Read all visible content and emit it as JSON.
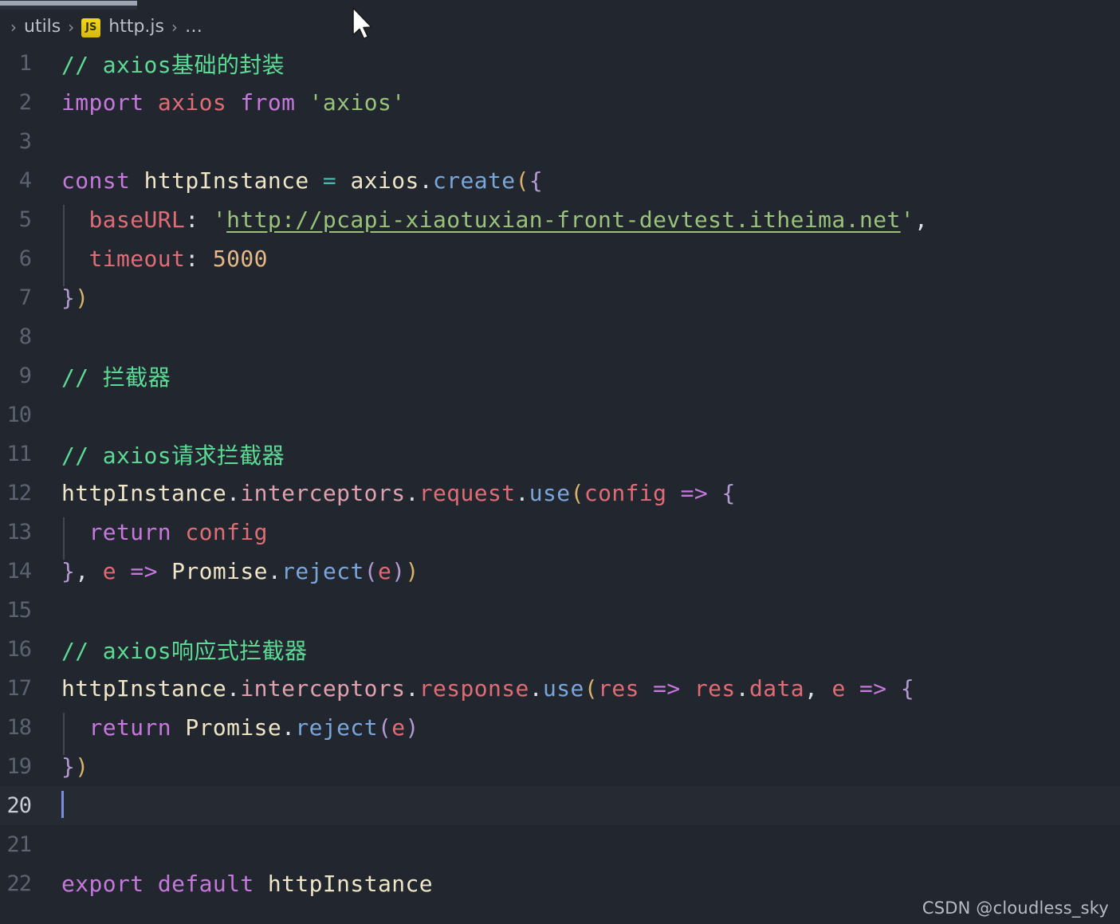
{
  "window": {
    "app": "Visual Studio Code",
    "theme_background": "#22262e"
  },
  "tab": {
    "label": "http.js",
    "active": true
  },
  "breadcrumb": {
    "separator": "›",
    "items": [
      {
        "label": "utils",
        "icon": "folder-icon"
      },
      {
        "label": "http.js",
        "icon": "js-file-icon",
        "badge": "JS"
      },
      {
        "label": "…",
        "icon": "ellipsis-icon"
      }
    ]
  },
  "editor": {
    "filename": "http.js",
    "language": "javascript",
    "active_line": 20,
    "cursor_line": 20,
    "cursor_column": 1,
    "total_lines_visible": 22,
    "lines": [
      {
        "n": 1,
        "tokens": [
          {
            "t": "// axios基础的封装",
            "c": "t-comment"
          }
        ]
      },
      {
        "n": 2,
        "tokens": [
          {
            "t": "import",
            "c": "t-keyword"
          },
          {
            "t": " ",
            "c": "t-plain"
          },
          {
            "t": "axios",
            "c": "t-var"
          },
          {
            "t": " ",
            "c": "t-plain"
          },
          {
            "t": "from",
            "c": "t-keyword"
          },
          {
            "t": " ",
            "c": "t-plain"
          },
          {
            "t": "'axios'",
            "c": "t-string"
          }
        ]
      },
      {
        "n": 3,
        "tokens": []
      },
      {
        "n": 4,
        "tokens": [
          {
            "t": "const",
            "c": "t-keyword"
          },
          {
            "t": " ",
            "c": "t-plain"
          },
          {
            "t": "httpInstance",
            "c": "t-ident"
          },
          {
            "t": " ",
            "c": "t-plain"
          },
          {
            "t": "=",
            "c": "t-op"
          },
          {
            "t": " ",
            "c": "t-plain"
          },
          {
            "t": "axios",
            "c": "t-ident"
          },
          {
            "t": ".",
            "c": "t-plain"
          },
          {
            "t": "create",
            "c": "t-method"
          },
          {
            "t": "(",
            "c": "t-paren1"
          },
          {
            "t": "{",
            "c": "t-paren2"
          }
        ]
      },
      {
        "n": 5,
        "indent": true,
        "tokens": [
          {
            "t": "  ",
            "c": "t-plain"
          },
          {
            "t": "baseURL",
            "c": "t-var"
          },
          {
            "t": ": ",
            "c": "t-plain"
          },
          {
            "t": "'",
            "c": "t-string"
          },
          {
            "t": "http://pcapi-xiaotuxian-front-devtest.itheima.net",
            "c": "t-link"
          },
          {
            "t": "'",
            "c": "t-string"
          },
          {
            "t": ",",
            "c": "t-plain"
          }
        ]
      },
      {
        "n": 6,
        "indent": true,
        "tokens": [
          {
            "t": "  ",
            "c": "t-plain"
          },
          {
            "t": "timeout",
            "c": "t-var"
          },
          {
            "t": ": ",
            "c": "t-plain"
          },
          {
            "t": "5000",
            "c": "t-number"
          }
        ]
      },
      {
        "n": 7,
        "tokens": [
          {
            "t": "}",
            "c": "t-paren2"
          },
          {
            "t": ")",
            "c": "t-paren1"
          }
        ]
      },
      {
        "n": 8,
        "tokens": []
      },
      {
        "n": 9,
        "tokens": [
          {
            "t": "// 拦截器",
            "c": "t-comment"
          }
        ]
      },
      {
        "n": 10,
        "tokens": []
      },
      {
        "n": 11,
        "tokens": [
          {
            "t": "// axios请求拦截器",
            "c": "t-comment"
          }
        ]
      },
      {
        "n": 12,
        "tokens": [
          {
            "t": "httpInstance",
            "c": "t-ident"
          },
          {
            "t": ".",
            "c": "t-plain"
          },
          {
            "t": "interceptors",
            "c": "t-prop"
          },
          {
            "t": ".",
            "c": "t-plain"
          },
          {
            "t": "request",
            "c": "t-var"
          },
          {
            "t": ".",
            "c": "t-plain"
          },
          {
            "t": "use",
            "c": "t-method"
          },
          {
            "t": "(",
            "c": "t-paren1"
          },
          {
            "t": "config",
            "c": "t-var"
          },
          {
            "t": " ",
            "c": "t-plain"
          },
          {
            "t": "=>",
            "c": "t-arrow"
          },
          {
            "t": " ",
            "c": "t-plain"
          },
          {
            "t": "{",
            "c": "t-paren2"
          }
        ]
      },
      {
        "n": 13,
        "indent": true,
        "tokens": [
          {
            "t": "  ",
            "c": "t-plain"
          },
          {
            "t": "return",
            "c": "t-keyword"
          },
          {
            "t": " ",
            "c": "t-plain"
          },
          {
            "t": "config",
            "c": "t-var"
          }
        ]
      },
      {
        "n": 14,
        "tokens": [
          {
            "t": "}",
            "c": "t-paren2"
          },
          {
            "t": ", ",
            "c": "t-plain"
          },
          {
            "t": "e",
            "c": "t-var"
          },
          {
            "t": " ",
            "c": "t-plain"
          },
          {
            "t": "=>",
            "c": "t-arrow"
          },
          {
            "t": " ",
            "c": "t-plain"
          },
          {
            "t": "Promise",
            "c": "t-ident"
          },
          {
            "t": ".",
            "c": "t-plain"
          },
          {
            "t": "reject",
            "c": "t-method"
          },
          {
            "t": "(",
            "c": "t-paren2"
          },
          {
            "t": "e",
            "c": "t-var"
          },
          {
            "t": ")",
            "c": "t-paren2"
          },
          {
            "t": ")",
            "c": "t-paren1"
          }
        ]
      },
      {
        "n": 15,
        "tokens": []
      },
      {
        "n": 16,
        "tokens": [
          {
            "t": "// axios响应式拦截器",
            "c": "t-comment"
          }
        ]
      },
      {
        "n": 17,
        "tokens": [
          {
            "t": "httpInstance",
            "c": "t-ident"
          },
          {
            "t": ".",
            "c": "t-plain"
          },
          {
            "t": "interceptors",
            "c": "t-prop"
          },
          {
            "t": ".",
            "c": "t-plain"
          },
          {
            "t": "response",
            "c": "t-var"
          },
          {
            "t": ".",
            "c": "t-plain"
          },
          {
            "t": "use",
            "c": "t-method"
          },
          {
            "t": "(",
            "c": "t-paren1"
          },
          {
            "t": "res",
            "c": "t-var"
          },
          {
            "t": " ",
            "c": "t-plain"
          },
          {
            "t": "=>",
            "c": "t-arrow"
          },
          {
            "t": " ",
            "c": "t-plain"
          },
          {
            "t": "res",
            "c": "t-var"
          },
          {
            "t": ".",
            "c": "t-plain"
          },
          {
            "t": "data",
            "c": "t-var"
          },
          {
            "t": ", ",
            "c": "t-plain"
          },
          {
            "t": "e",
            "c": "t-var"
          },
          {
            "t": " ",
            "c": "t-plain"
          },
          {
            "t": "=>",
            "c": "t-arrow"
          },
          {
            "t": " ",
            "c": "t-plain"
          },
          {
            "t": "{",
            "c": "t-paren2"
          }
        ]
      },
      {
        "n": 18,
        "indent": true,
        "tokens": [
          {
            "t": "  ",
            "c": "t-plain"
          },
          {
            "t": "return",
            "c": "t-keyword"
          },
          {
            "t": " ",
            "c": "t-plain"
          },
          {
            "t": "Promise",
            "c": "t-ident"
          },
          {
            "t": ".",
            "c": "t-plain"
          },
          {
            "t": "reject",
            "c": "t-method"
          },
          {
            "t": "(",
            "c": "t-paren2"
          },
          {
            "t": "e",
            "c": "t-var"
          },
          {
            "t": ")",
            "c": "t-paren2"
          }
        ]
      },
      {
        "n": 19,
        "tokens": [
          {
            "t": "}",
            "c": "t-paren2"
          },
          {
            "t": ")",
            "c": "t-paren1"
          }
        ]
      },
      {
        "n": 20,
        "active": true,
        "cursor": true,
        "tokens": []
      },
      {
        "n": 21,
        "tokens": []
      },
      {
        "n": 22,
        "tokens": [
          {
            "t": "export",
            "c": "t-keyword"
          },
          {
            "t": " ",
            "c": "t-plain"
          },
          {
            "t": "default",
            "c": "t-keyword"
          },
          {
            "t": " ",
            "c": "t-plain"
          },
          {
            "t": "httpInstance",
            "c": "t-ident"
          }
        ]
      }
    ]
  },
  "watermark": {
    "text": "CSDN @cloudless_sky"
  },
  "colors": {
    "background": "#22262e",
    "line_number": "#5c6370",
    "active_line_number": "#c8ccd4",
    "comment": "#5cdb95",
    "keyword": "#c678dd",
    "string": "#98c379",
    "variable": "#e06c75",
    "method": "#7aa6da",
    "number": "#e5b887",
    "identifier": "#efe6c8",
    "operator": "#4db6ac",
    "cursor": "#7a8ee0",
    "js_badge": "#efd81d"
  }
}
